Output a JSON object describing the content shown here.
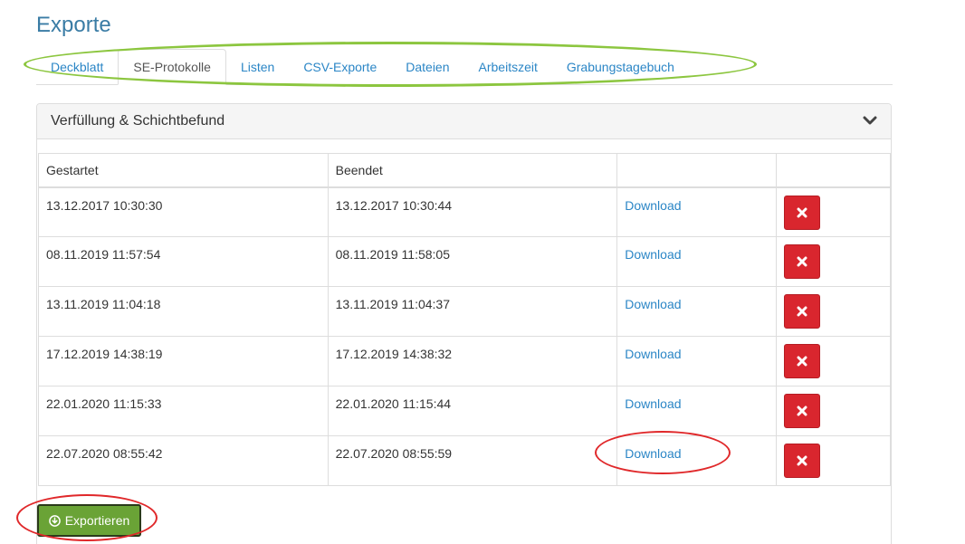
{
  "page": {
    "title": "Exporte"
  },
  "tabs": [
    {
      "label": "Deckblatt",
      "active": false
    },
    {
      "label": "SE-Protokolle",
      "active": true
    },
    {
      "label": "Listen",
      "active": false
    },
    {
      "label": "CSV-Exporte",
      "active": false
    },
    {
      "label": "Dateien",
      "active": false
    },
    {
      "label": "Arbeitszeit",
      "active": false
    },
    {
      "label": "Grabungstagebuch",
      "active": false
    }
  ],
  "panel": {
    "title": "Verfüllung & Schichtbefund",
    "toggle_icon": "chevron-down-icon"
  },
  "table": {
    "headers": [
      "Gestartet",
      "Beendet",
      "",
      ""
    ],
    "rows": [
      {
        "started": "13.12.2017 10:30:30",
        "ended": "13.12.2017 10:30:44",
        "download": "Download"
      },
      {
        "started": "08.11.2019 11:57:54",
        "ended": "08.11.2019 11:58:05",
        "download": "Download"
      },
      {
        "started": "13.11.2019 11:04:18",
        "ended": "13.11.2019 11:04:37",
        "download": "Download"
      },
      {
        "started": "17.12.2019 14:38:19",
        "ended": "17.12.2019 14:38:32",
        "download": "Download"
      },
      {
        "started": "22.01.2020 11:15:33",
        "ended": "22.01.2020 11:15:44",
        "download": "Download"
      },
      {
        "started": "22.07.2020 08:55:42",
        "ended": "22.07.2020 08:55:59",
        "download": "Download"
      }
    ],
    "delete_icon": "times-icon"
  },
  "actions": {
    "export_label": "Exportieren",
    "export_icon": "download-circle-icon"
  },
  "colors": {
    "title": "#3a7ca5",
    "link": "#2b86c6",
    "delete": "#d9262e",
    "export": "#6aa336",
    "highlight_green": "#8cc63f",
    "highlight_red": "#e0282a"
  }
}
